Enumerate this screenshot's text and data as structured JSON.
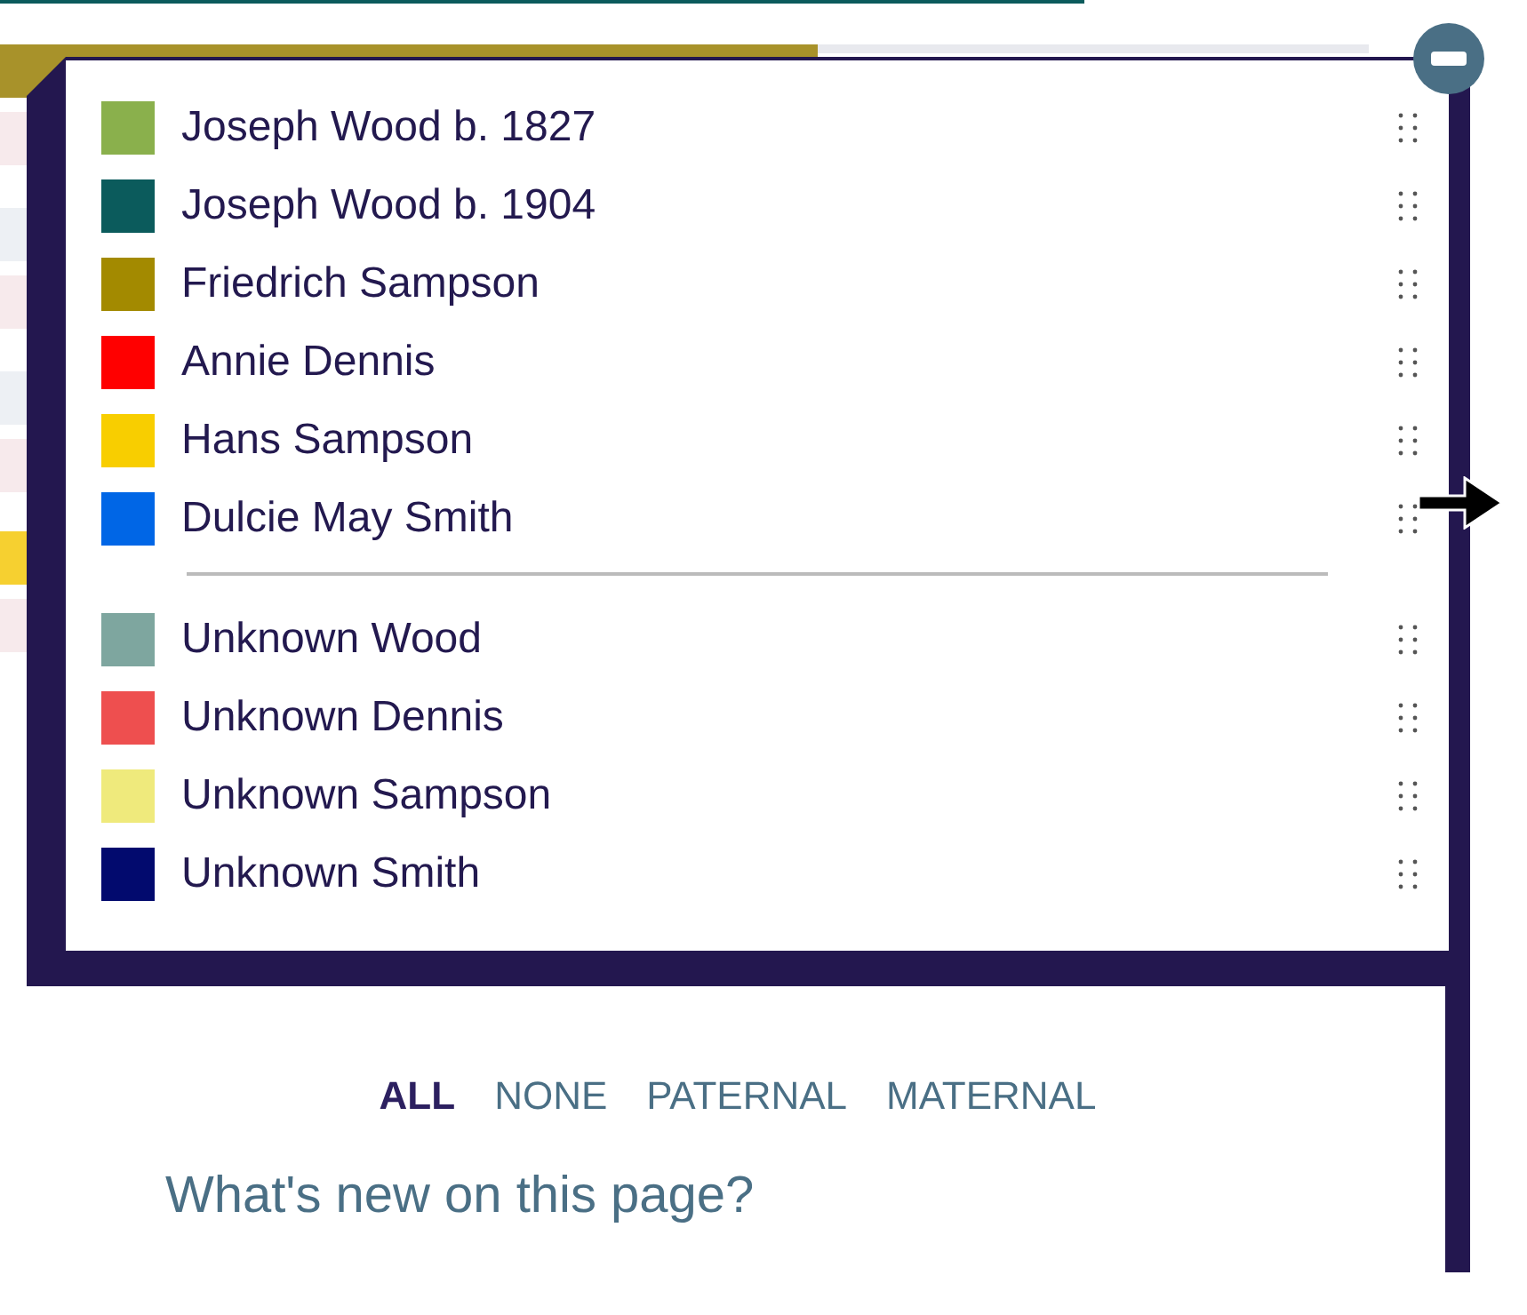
{
  "legend": {
    "groups": [
      {
        "items": [
          {
            "label": "Joseph Wood b. 1827",
            "color": "#8ab04c"
          },
          {
            "label": "Joseph Wood b. 1904",
            "color": "#0b5b5c"
          },
          {
            "label": "Friedrich Sampson",
            "color": "#a38a00"
          },
          {
            "label": "Annie Dennis",
            "color": "#ff0000"
          },
          {
            "label": "Hans Sampson",
            "color": "#f8ce00"
          },
          {
            "label": "Dulcie May Smith",
            "color": "#0066e6"
          }
        ]
      },
      {
        "items": [
          {
            "label": "Unknown Wood",
            "color": "#7ea69f"
          },
          {
            "label": "Unknown Dennis",
            "color": "#ee4f4f"
          },
          {
            "label": "Unknown Sampson",
            "color": "#efea7c"
          },
          {
            "label": "Unknown Smith",
            "color": "#020a6e"
          }
        ]
      }
    ]
  },
  "filters": [
    {
      "label": "ALL",
      "selected": true
    },
    {
      "label": "NONE",
      "selected": false
    },
    {
      "label": "PATERNAL",
      "selected": false
    },
    {
      "label": "MATERNAL",
      "selected": false
    }
  ],
  "whats_new": "What's new on this page?"
}
